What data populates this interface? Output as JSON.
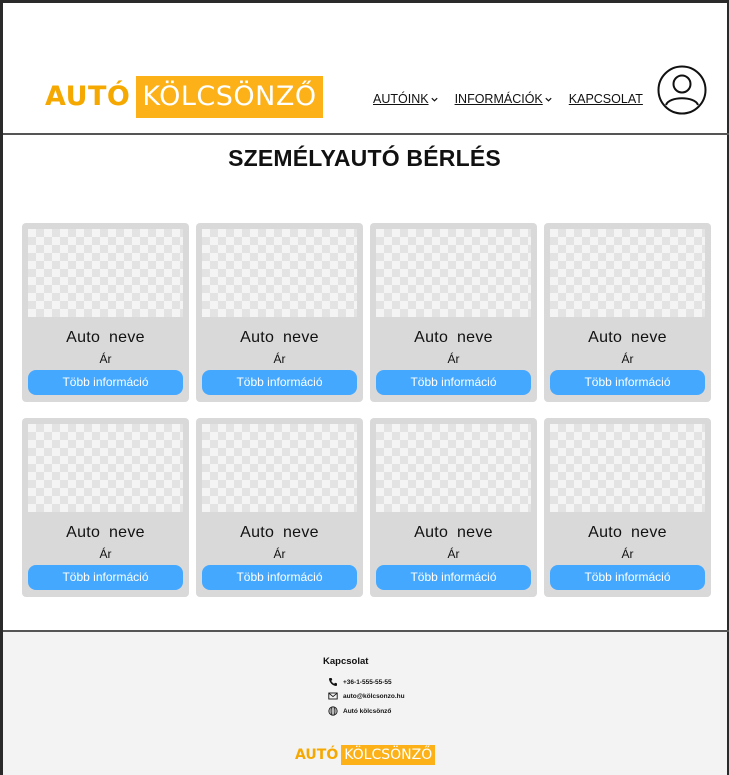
{
  "brand": {
    "part1": "AUTÓ",
    "part2": "KÖLCSÖNZŐ"
  },
  "nav": [
    {
      "label": "AUTÓINK",
      "dropdown": true
    },
    {
      "label": "INFORMÁCIÓK",
      "dropdown": true
    },
    {
      "label": "KAPCSOLAT",
      "dropdown": false
    }
  ],
  "page": {
    "title": "SZEMÉLYAUTÓ BÉRLÉS"
  },
  "cards": [
    {
      "name": "Auto neve",
      "price": "Ár",
      "button": "Több információ"
    },
    {
      "name": "Auto neve",
      "price": "Ár",
      "button": "Több információ"
    },
    {
      "name": "Auto neve",
      "price": "Ár",
      "button": "Több információ"
    },
    {
      "name": "Auto neve",
      "price": "Ár",
      "button": "Több információ"
    },
    {
      "name": "Auto neve",
      "price": "Ár",
      "button": "Több információ"
    },
    {
      "name": "Auto neve",
      "price": "Ár",
      "button": "Több információ"
    },
    {
      "name": "Auto neve",
      "price": "Ár",
      "button": "Több információ"
    },
    {
      "name": "Auto neve",
      "price": "Ár",
      "button": "Több információ"
    }
  ],
  "footer": {
    "title": "Kapcsolat",
    "phone": "+36-1-555-55-55",
    "email": "auto@kölcsonzo.hu",
    "website": "Autó kölcsönző",
    "logo": {
      "part1": "AUTÓ",
      "part2": "KÖLCSÖNZŐ"
    }
  },
  "colors": {
    "brand_orange": "#fbb117",
    "button_blue": "#45a8ff",
    "card_gray": "#d9d9d9"
  },
  "icons": {
    "user": "user-circle-icon",
    "phone": "phone-icon",
    "email": "envelope-icon",
    "web": "globe-icon",
    "dropdown": "chevron-down-icon"
  }
}
